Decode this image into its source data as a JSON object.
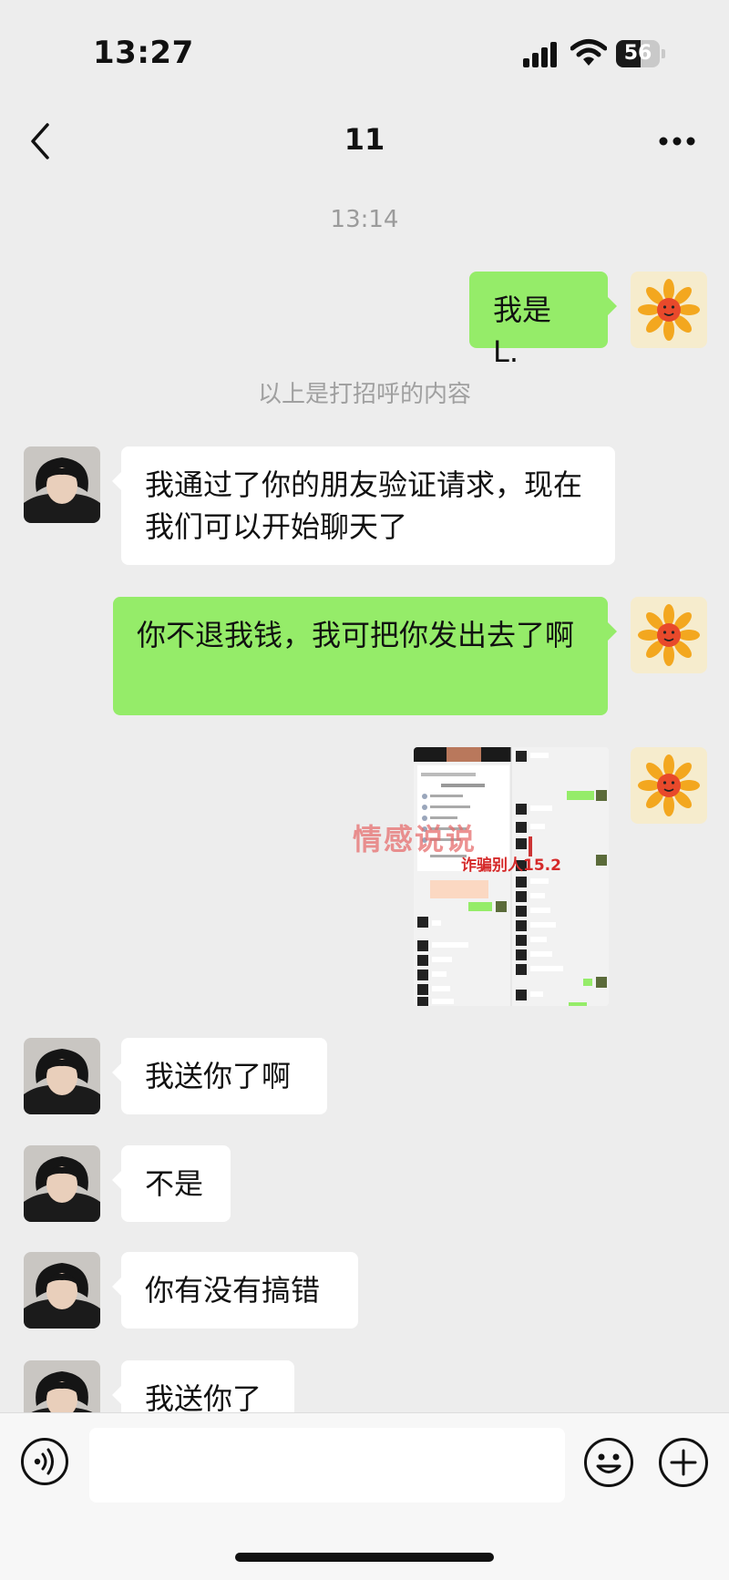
{
  "status_bar": {
    "time": "13:27",
    "battery": "56",
    "battery_level_pct": 56
  },
  "header": {
    "title": "11"
  },
  "thread": {
    "timestamp": "13:14",
    "system_note": "以上是打招呼的内容",
    "messages": [
      {
        "side": "out",
        "type": "text",
        "text": "我是 L."
      },
      {
        "side": "in",
        "type": "text",
        "text": "我通过了你的朋友验证请求，现在我们可以开始聊天了"
      },
      {
        "side": "out",
        "type": "text",
        "text": "你不退我钱，我可把你发出去了啊"
      },
      {
        "side": "out",
        "type": "image",
        "caption": "诈骗别人15.2"
      },
      {
        "side": "in",
        "type": "text",
        "text": "我送你了啊"
      },
      {
        "side": "in",
        "type": "text",
        "text": "不是"
      },
      {
        "side": "in",
        "type": "text",
        "text": "你有没有搞错"
      },
      {
        "side": "in",
        "type": "text",
        "text": "我送你了"
      }
    ]
  },
  "watermark": "情感说说",
  "input_bar": {
    "placeholder": ""
  },
  "icons": {
    "back": "chevron-left-icon",
    "more": "ellipsis-icon",
    "voice": "voice-icon",
    "emoji": "smiley-icon",
    "add": "plus-icon"
  },
  "colors": {
    "background": "#ededed",
    "outgoing_bubble": "#95ec69",
    "incoming_bubble": "#ffffff"
  }
}
